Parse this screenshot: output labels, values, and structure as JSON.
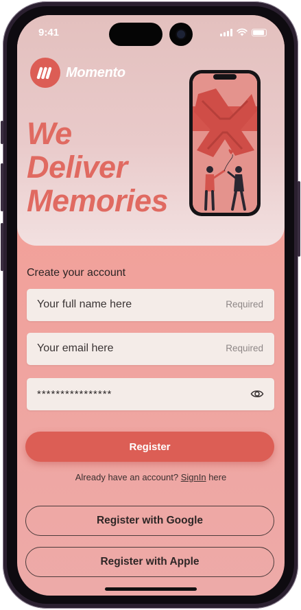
{
  "status_bar": {
    "time": "9:41"
  },
  "brand": {
    "name": "Momento"
  },
  "hero": {
    "headline_lines": [
      "We",
      "Deliver",
      "Memories"
    ]
  },
  "form": {
    "section_title": "Create your account",
    "full_name": {
      "placeholder": "Your full name here",
      "hint": "Required"
    },
    "email": {
      "placeholder": "Your email here",
      "hint": "Required"
    },
    "password": {
      "value": "****************"
    }
  },
  "actions": {
    "register_label": "Register",
    "signin_prefix": "Already have an account?",
    "signin_link": "SignIn",
    "signin_suffix": "here",
    "google_label": "Register with Google",
    "apple_label": "Register with Apple"
  },
  "colors": {
    "accent": "#dc5e55",
    "headline": "#e06a61",
    "field_bg": "#f4ece8"
  },
  "icons": {
    "logo": "momento-logo-icon",
    "password_toggle": "eye-icon"
  }
}
